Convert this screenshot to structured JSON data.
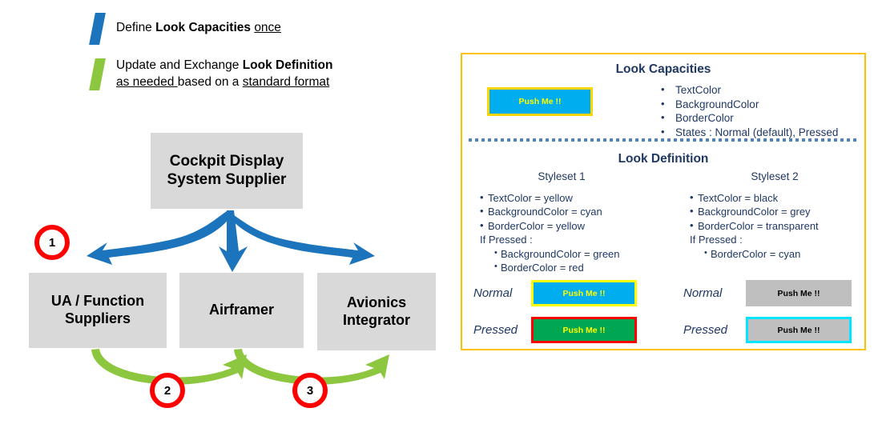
{
  "legend": [
    {
      "swatch_color": "#1C75BC",
      "swatch_name": "blue-slant-marker",
      "line1_pre": "Define ",
      "line1_bold": "Look Capacities",
      "line1_post": " ",
      "line1_underline": "once",
      "line2": ""
    },
    {
      "swatch_color": "#8DC63F",
      "swatch_name": "green-slant-marker",
      "line1_pre": "Update and Exchange ",
      "line1_bold": "Look Definition",
      "line2_underline_a": "as needed ",
      "line2_mid": "based on a ",
      "line2_underline_b": "standard format"
    }
  ],
  "flow": {
    "boxes": {
      "cockpit_display_system_supplier": "Cockpit Display\nSystem Supplier",
      "cockpit_display_line1": "Cockpit Display",
      "cockpit_display_line2": "System Supplier",
      "ua_function_line1": "UA / Function",
      "ua_function_line2": "Suppliers",
      "airframer": "Airframer",
      "avionics_line1": "Avionics",
      "avionics_line2": "Integrator"
    },
    "badges": [
      "1",
      "2",
      "3"
    ],
    "colors": {
      "box_fill": "#D9D9D9",
      "blue_arrow": "#1C75BC",
      "green_arrow": "#8DC63F",
      "badge_ring": "#FF0000"
    }
  },
  "panel": {
    "border_color": "#FFC000",
    "capacities": {
      "title": "Look Capacities",
      "button_label": "Push Me !!",
      "button_bg": "#00AEEF",
      "button_border": "#FFD400",
      "button_text_color": "#FFFF00",
      "items": [
        "TextColor",
        "BackgroundColor",
        "BorderColor",
        "States : Normal (default), Pressed"
      ],
      "callout_color": "#FF3B30"
    },
    "definition": {
      "title": "Look Definition",
      "stylesets": [
        {
          "head": "Styleset 1",
          "props": [
            {
              "level": 1,
              "text": "TextColor  =  yellow"
            },
            {
              "level": 1,
              "text": "BackgroundColor  =  cyan"
            },
            {
              "level": 1,
              "text": "BorderColor  =  yellow"
            }
          ],
          "if_pressed_label": "If Pressed :",
          "pressed_props": [
            {
              "level": 2,
              "text": "BackgroundColor  =  green"
            },
            {
              "level": 2,
              "text": "BorderColor  =  red"
            }
          ],
          "samples": [
            {
              "state": "Normal",
              "label": "Push Me !!"
            },
            {
              "state": "Pressed",
              "label": "Push Me !!"
            }
          ]
        },
        {
          "head": "Styleset 2",
          "props": [
            {
              "level": 1,
              "text": "TextColor  =  black"
            },
            {
              "level": 1,
              "text": "BackgroundColor  =  grey"
            },
            {
              "level": 1,
              "text": "BorderColor  =  transparent"
            }
          ],
          "if_pressed_label": "If Pressed :",
          "pressed_props": [
            {
              "level": 2,
              "text": "BorderColor  =  cyan"
            }
          ],
          "samples": [
            {
              "state": "Normal",
              "label": "Push Me !!"
            },
            {
              "state": "Pressed",
              "label": "Push Me !!"
            }
          ]
        }
      ]
    }
  }
}
